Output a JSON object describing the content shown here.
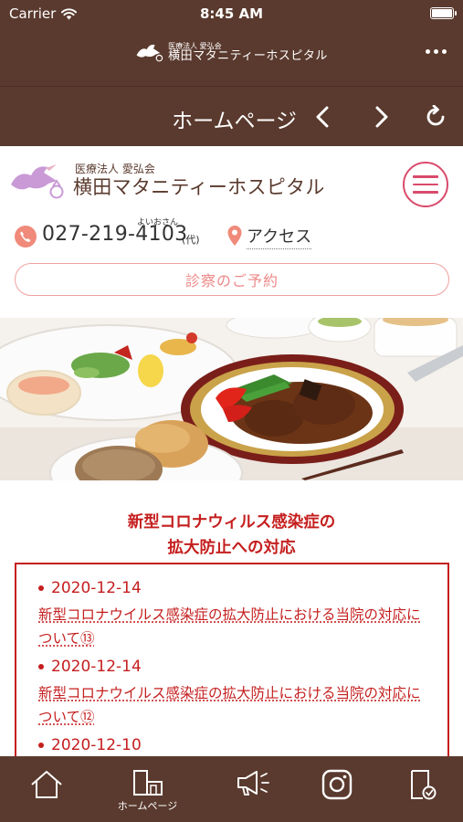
{
  "status_bar": {
    "carrier": "Carrier",
    "time": "8:45 AM"
  },
  "header": {
    "logo_small": "医療法人 愛弘会",
    "logo_big": "横田マタニティーホスピタル"
  },
  "nav": {
    "title": "ホームページ"
  },
  "site": {
    "logo_small": "医療法人 愛弘会",
    "logo_big": "横田マタニティーホスピタル",
    "phone": "027-219-4103",
    "phone_ruby": "よいおさん",
    "phone_suffix": "(代)",
    "access_label": "アクセス",
    "reserve_label": "診察のご予約"
  },
  "covid": {
    "title_line1": "新型コロナウィルス感染症の",
    "title_line2": "拡大防止への対応",
    "items": [
      {
        "date": "2020-12-14",
        "title": "新型コロナウイルス感染症の拡大防止における当院の対応について⑬"
      },
      {
        "date": "2020-12-14",
        "title": "新型コロナウイルス感染症の拡大防止における当院の対応について⑫"
      },
      {
        "date": "2020-12-10",
        "title": ""
      }
    ]
  },
  "tabs": [
    {
      "icon": "house-icon",
      "label": ""
    },
    {
      "icon": "homepage-icon",
      "label": "ホームページ"
    },
    {
      "icon": "megaphone-icon",
      "label": ""
    },
    {
      "icon": "instagram-icon",
      "label": ""
    },
    {
      "icon": "document-check-icon",
      "label": ""
    }
  ],
  "colors": {
    "brown": "#5a3a2e",
    "accent_red": "#c51e1e",
    "accent_pink": "#d94b6b"
  }
}
